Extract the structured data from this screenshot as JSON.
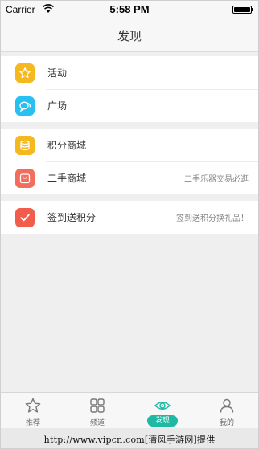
{
  "status_bar": {
    "carrier": "Carrier",
    "time": "5:58 PM"
  },
  "nav": {
    "title": "发现"
  },
  "groups": [
    {
      "items": [
        {
          "label": "活动",
          "icon": "star-icon",
          "color": "#f5b81e"
        },
        {
          "label": "广场",
          "icon": "chat-bubbles-icon",
          "color": "#27c0f0"
        }
      ]
    },
    {
      "items": [
        {
          "label": "积分商城",
          "icon": "coins-icon",
          "color": "#f5b81e"
        },
        {
          "label": "二手商城",
          "icon": "bag-icon",
          "color": "#f26d5b",
          "hint": "二手乐器交易必逛"
        }
      ]
    },
    {
      "items": [
        {
          "label": "签到送积分",
          "icon": "checkmark-icon",
          "color": "#f25c4a",
          "hint": "签到送积分换礼品！"
        }
      ]
    }
  ],
  "tabs": [
    {
      "label": "推荐",
      "icon": "star-outline-icon"
    },
    {
      "label": "频道",
      "icon": "grid-icon"
    },
    {
      "label": "发现",
      "icon": "eye-icon",
      "active": true,
      "accent": "#1fb8a3"
    },
    {
      "label": "我的",
      "icon": "person-icon"
    }
  ],
  "watermark": "http://www.vipcn.com[清风手游网]提供"
}
